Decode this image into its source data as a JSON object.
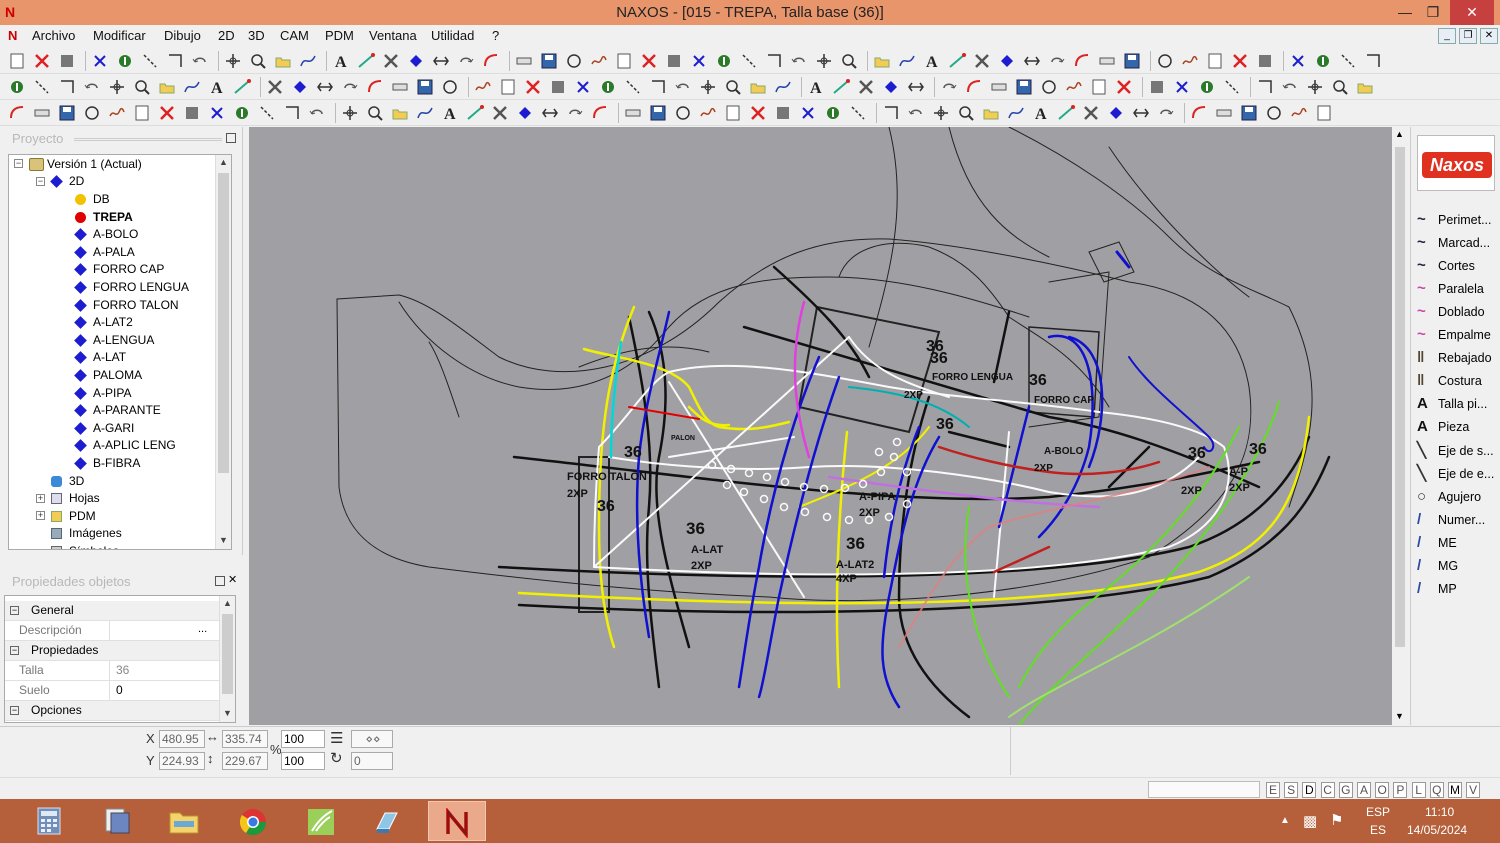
{
  "window": {
    "title": "NAXOS - [015 - TREPA, Talla base (36)]",
    "logo": "N",
    "controls": [
      "minimize-icon",
      "restore-icon",
      "close-icon"
    ]
  },
  "menu": {
    "items": [
      "Archivo",
      "Modificar",
      "Dibujo",
      "2D",
      "3D",
      "CAM",
      "PDM",
      "Ventana",
      "Utilidad",
      "?"
    ]
  },
  "project_panel": {
    "title": "Proyecto",
    "tree": {
      "root": "Versión 1 (Actual)",
      "folder_2d": "2D",
      "layers": [
        {
          "label": "DB",
          "color": "#f2c100"
        },
        {
          "label": "TREPA",
          "color": "#e00000",
          "bold": true
        },
        {
          "label": "A-BOLO",
          "color": "#1c1cd0"
        },
        {
          "label": "A-PALA",
          "color": "#1c1cd0"
        },
        {
          "label": "FORRO CAP",
          "color": "#1c1cd0"
        },
        {
          "label": "FORRO LENGUA",
          "color": "#1c1cd0"
        },
        {
          "label": "FORRO TALON",
          "color": "#1c1cd0"
        },
        {
          "label": "A-LAT2",
          "color": "#1c1cd0"
        },
        {
          "label": "A-LENGUA",
          "color": "#1c1cd0"
        },
        {
          "label": "A-LAT",
          "color": "#1c1cd0"
        },
        {
          "label": "PALOMA",
          "color": "#1c1cd0"
        },
        {
          "label": "A-PIPA",
          "color": "#1c1cd0"
        },
        {
          "label": "A-PARANTE",
          "color": "#1c1cd0"
        },
        {
          "label": "A-GARI",
          "color": "#1c1cd0"
        },
        {
          "label": "A-APLIC LENG",
          "color": "#1c1cd0"
        },
        {
          "label": "B-FIBRA",
          "color": "#1c1cd0"
        }
      ],
      "other": [
        "3D",
        "Hojas",
        "PDM",
        "Imágenes",
        "Símbolos"
      ]
    }
  },
  "properties_panel": {
    "title": "Propiedades objetos",
    "rows": [
      {
        "type": "category",
        "label": "General"
      },
      {
        "type": "prop",
        "key": "Descripción",
        "value": "",
        "button": "..."
      },
      {
        "type": "category",
        "label": "Propiedades"
      },
      {
        "type": "prop",
        "key": "Talla",
        "value": "36"
      },
      {
        "type": "prop",
        "key": "Suelo",
        "value": "0"
      },
      {
        "type": "category",
        "label": "Opciones"
      }
    ]
  },
  "canvas": {
    "labels": [
      {
        "text": "36"
      },
      {
        "text": "36"
      },
      {
        "text": "36"
      },
      {
        "text": "36"
      },
      {
        "text": "36"
      },
      {
        "text": "36"
      },
      {
        "text": "36"
      },
      {
        "text": "36"
      },
      {
        "text": "36"
      },
      {
        "text": "36"
      },
      {
        "text": "FORRO TALON"
      },
      {
        "text": "2XP"
      },
      {
        "text": "A-LAT"
      },
      {
        "text": "2XP"
      },
      {
        "text": "A-LAT2"
      },
      {
        "text": "4XP"
      },
      {
        "text": "A-PIPA"
      },
      {
        "text": "2XP"
      },
      {
        "text": "FORRO LENGUA"
      },
      {
        "text": "FORRO CAP"
      },
      {
        "text": "A-BOLO"
      },
      {
        "text": "2XP"
      },
      {
        "text": "A-P"
      },
      {
        "text": "2XP"
      },
      {
        "text": "2XP"
      },
      {
        "text": "2XP"
      },
      {
        "text": "PALON"
      }
    ]
  },
  "right_panel": {
    "brand": "Naxos",
    "items": [
      "Perimet...",
      "Marcad...",
      "Cortes",
      "Paralela",
      "Doblado",
      "Empalme",
      "Rebajado",
      "Costura",
      "Talla pi...",
      "Pieza",
      "Eje de s...",
      "Eje de e...",
      "Agujero",
      "Numer...",
      "ME",
      "MG",
      "MP"
    ]
  },
  "status": {
    "x_label": "X",
    "y_label": "Y",
    "x": "480.95",
    "y": "224.93",
    "width": "335.74",
    "height": "229.67",
    "scale_x": "100",
    "scale_y": "100",
    "percent": "%",
    "rotation": "0"
  },
  "flags": [
    "E",
    "S",
    "D",
    "C",
    "G",
    "A",
    "O",
    "P",
    "L",
    "Q",
    "M",
    "V"
  ],
  "taskbar": {
    "lang": "ESP",
    "region": "ES",
    "time": "11:10",
    "date": "14/05/2024"
  }
}
